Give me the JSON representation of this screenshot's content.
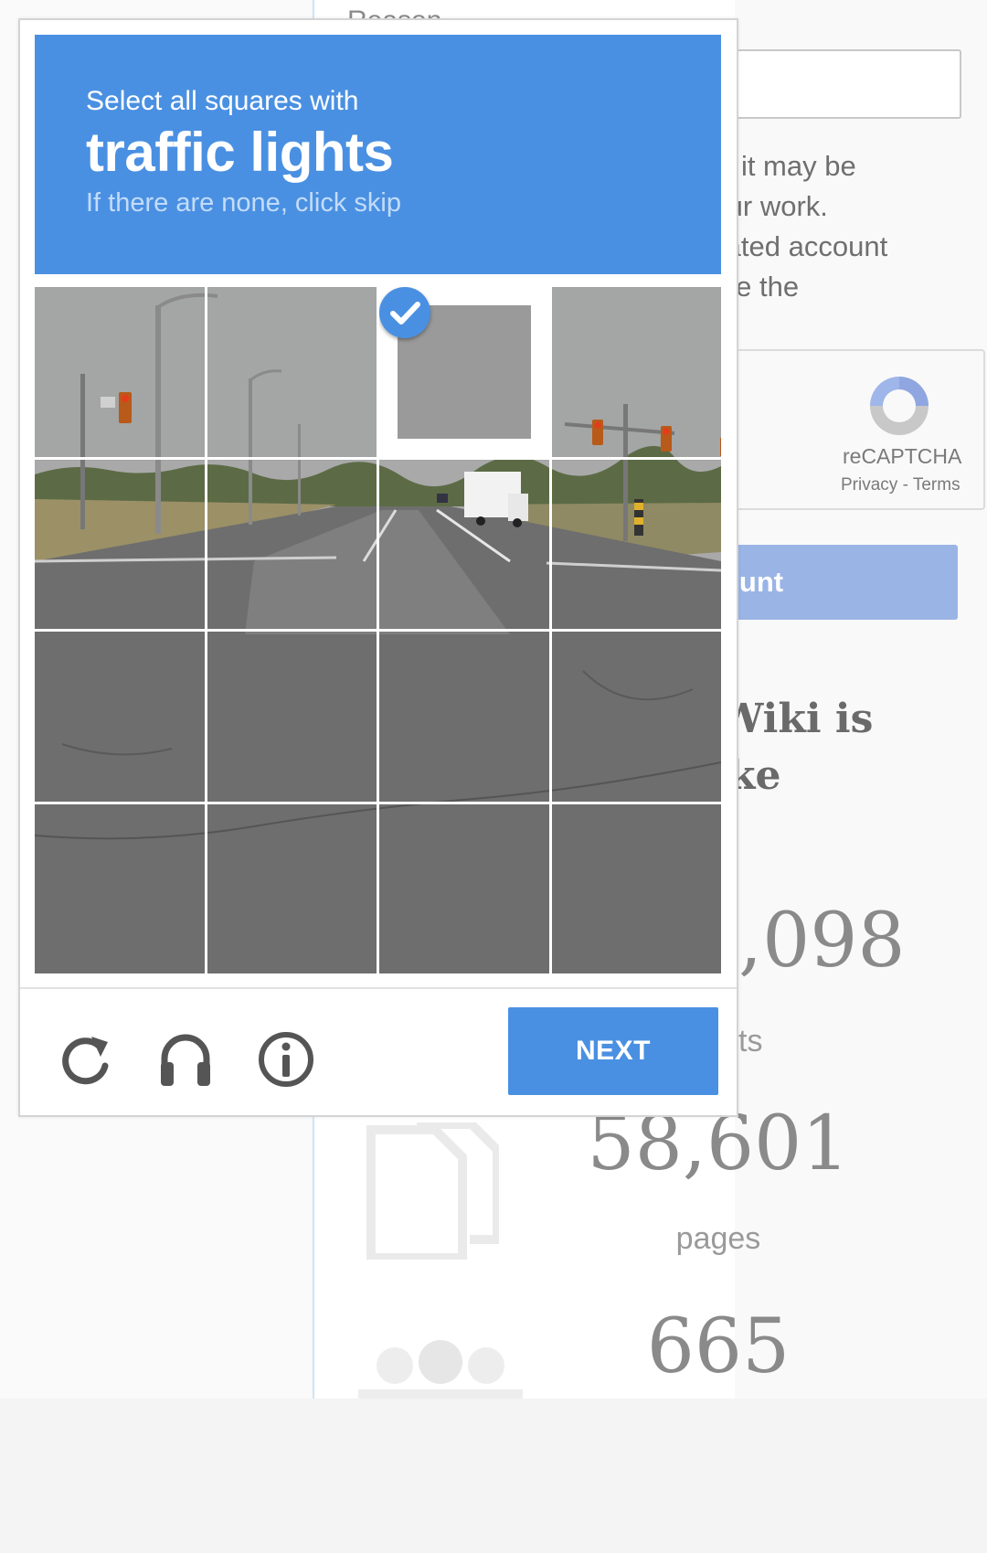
{
  "background": {
    "reason_label": "Reason",
    "paragraph_lines": [
      "ded, it may be",
      "r your work.",
      "tomated account",
      "solve the"
    ],
    "recaptcha": {
      "name": "reCAPTCHA",
      "privacy": "Privacy",
      "separator": " - ",
      "terms": "Terms"
    },
    "create_button_label": "ount",
    "wiki_heading_lines": [
      "Wiki is",
      "ke"
    ],
    "stats": {
      "edits_value": ",098",
      "edits_label": "ts",
      "pages_value": "58,601",
      "pages_label": "pages",
      "users_value": "665"
    }
  },
  "captcha": {
    "instruction": "Select all squares with",
    "target": "traffic lights",
    "hint": "If there are none, click skip",
    "grid_size": 4,
    "selected_tiles": [
      2
    ],
    "next_label": "NEXT",
    "icons": {
      "reload": "reload-icon",
      "audio": "headphones-icon",
      "info": "info-icon",
      "check": "checkmark-icon"
    },
    "colors": {
      "accent": "#4a90e2",
      "create_button": "#9ab4e6"
    }
  }
}
